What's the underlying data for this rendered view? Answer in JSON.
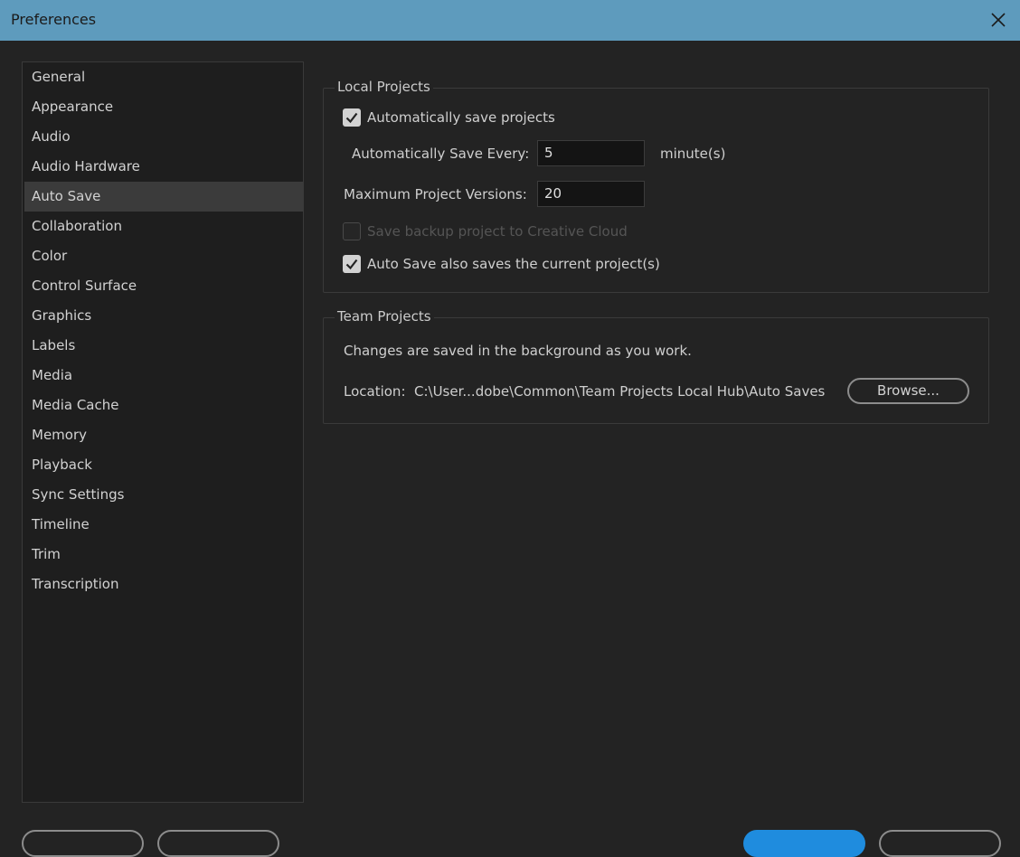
{
  "window": {
    "title": "Preferences",
    "close_icon": "close-icon"
  },
  "sidebar": {
    "selected": "Auto Save",
    "items": [
      {
        "label": "General"
      },
      {
        "label": "Appearance"
      },
      {
        "label": "Audio"
      },
      {
        "label": "Audio Hardware"
      },
      {
        "label": "Auto Save"
      },
      {
        "label": "Collaboration"
      },
      {
        "label": "Color"
      },
      {
        "label": "Control Surface"
      },
      {
        "label": "Graphics"
      },
      {
        "label": "Labels"
      },
      {
        "label": "Media"
      },
      {
        "label": "Media Cache"
      },
      {
        "label": "Memory"
      },
      {
        "label": "Playback"
      },
      {
        "label": "Sync Settings"
      },
      {
        "label": "Timeline"
      },
      {
        "label": "Trim"
      },
      {
        "label": "Transcription"
      }
    ]
  },
  "local_projects": {
    "title": "Local Projects",
    "auto_save_checkbox": {
      "label": "Automatically save projects",
      "checked": true
    },
    "save_every": {
      "label": "Automatically Save Every:",
      "value": "5",
      "unit": "minute(s)"
    },
    "max_versions": {
      "label": "Maximum Project Versions:",
      "value": "20"
    },
    "backup_cc_checkbox": {
      "label": "Save backup project to Creative Cloud",
      "checked": false,
      "disabled": true
    },
    "save_current_checkbox": {
      "label": "Auto Save also saves the current project(s)",
      "checked": true
    }
  },
  "team_projects": {
    "title": "Team Projects",
    "info": "Changes are saved in the background as you work.",
    "location_label": "Location:",
    "location_path": "C:\\User...dobe\\Common\\Team Projects Local Hub\\Auto Saves",
    "browse_label": "Browse..."
  },
  "colors": {
    "titlebar": "#5e9bbd",
    "background": "#232323",
    "primary_button": "#1f8cde"
  }
}
